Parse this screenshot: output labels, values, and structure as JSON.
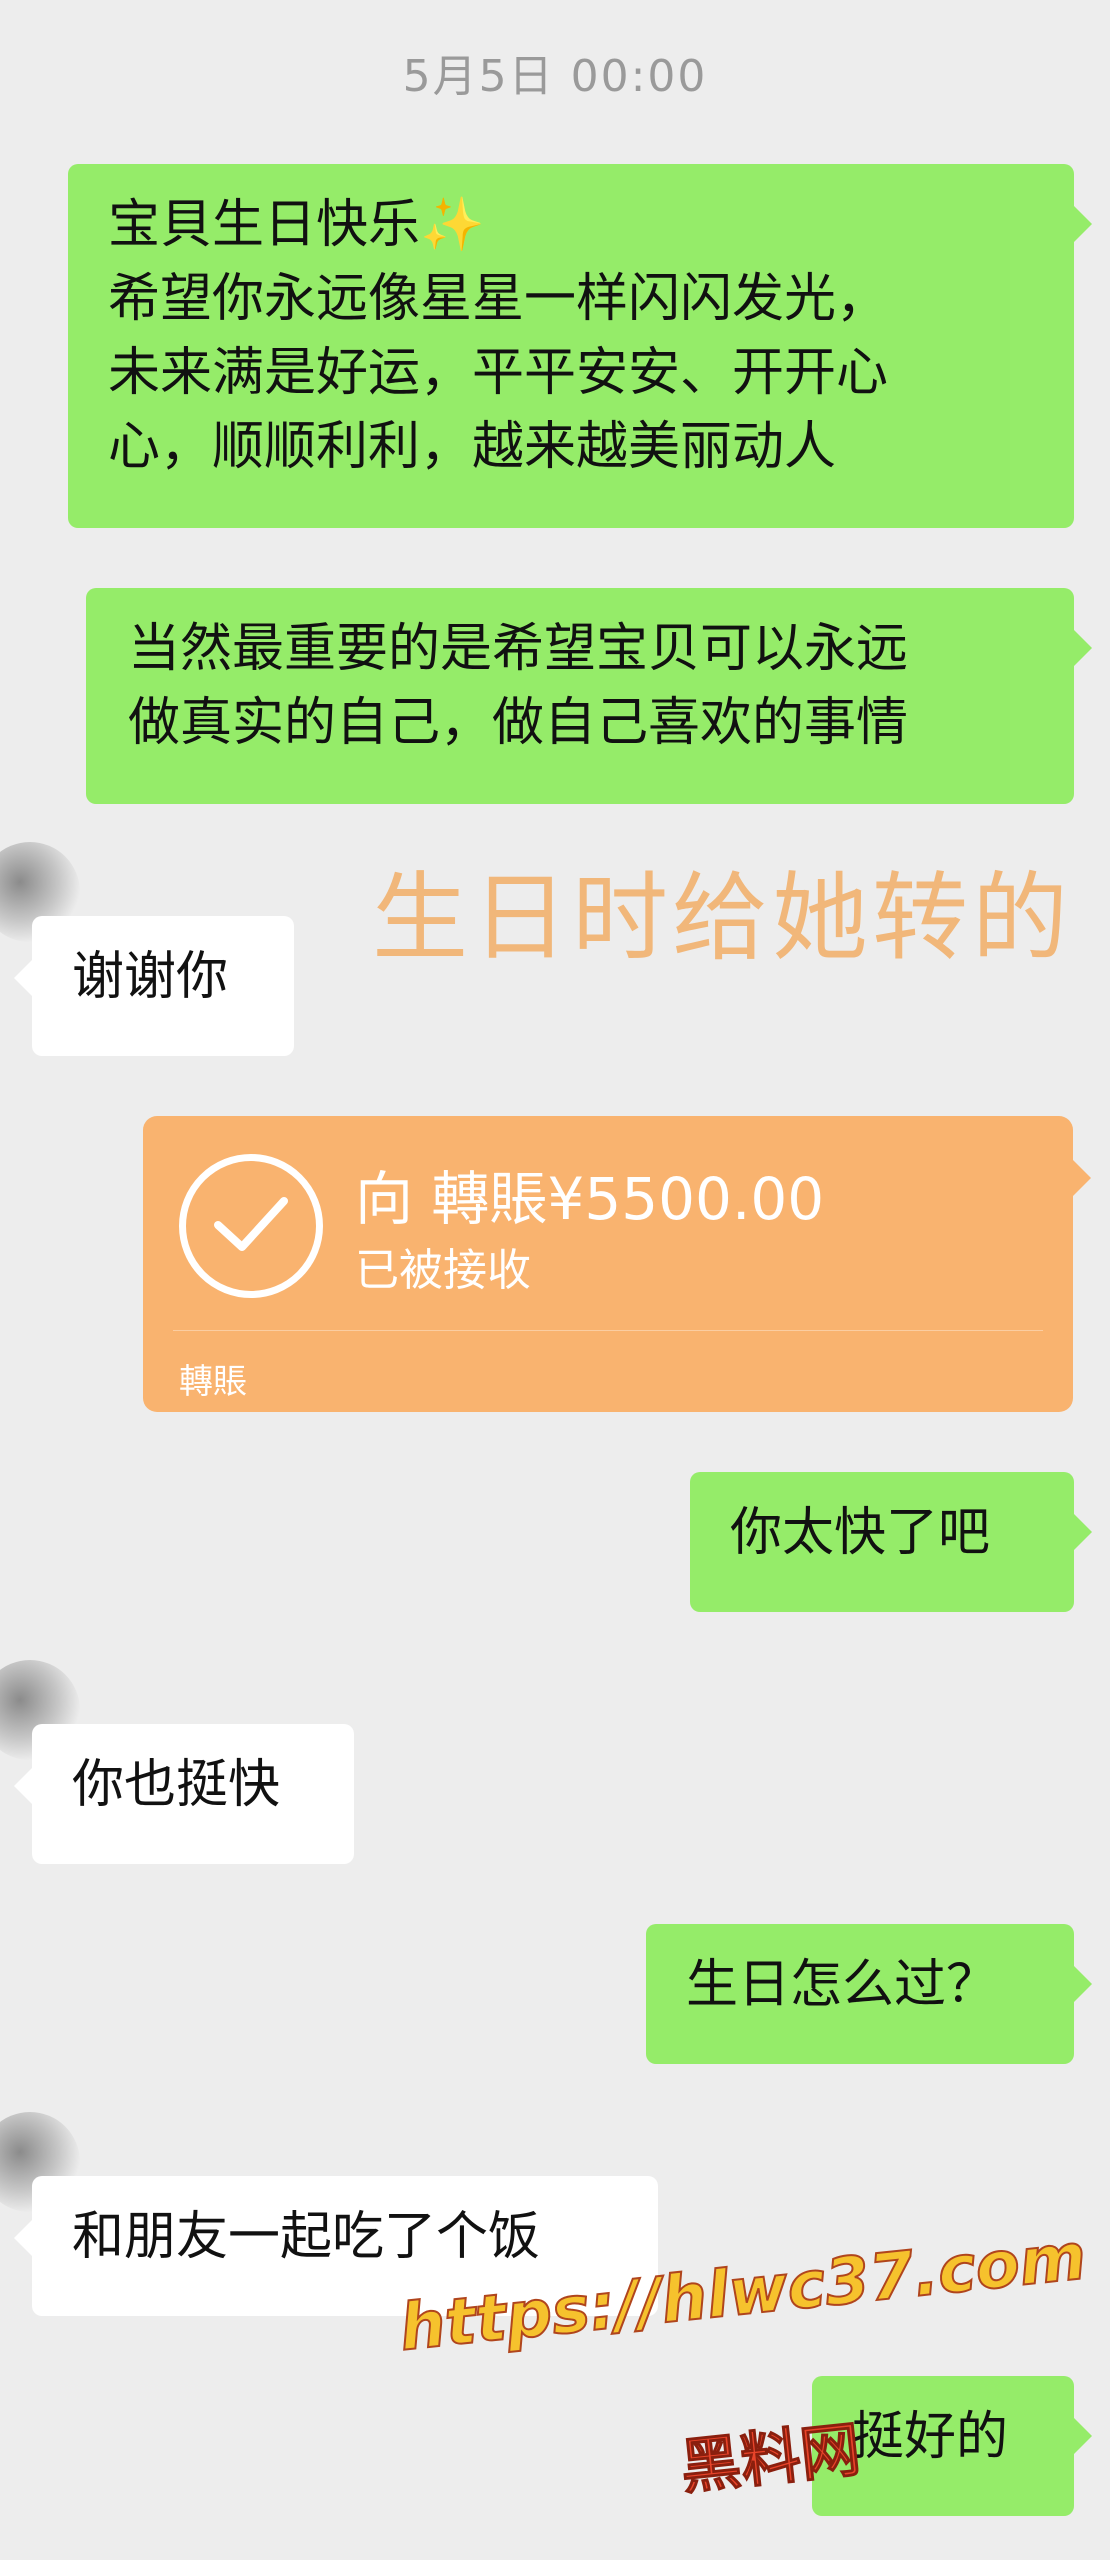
{
  "chat": {
    "timestamp": "5月5日 00:00",
    "messages": [
      {
        "text": "宝貝生日快乐✨\n希望你永远像星星一样闪闪发光，\n未来满是好运，平平安安、开开心\n心，顺顺利利，越来越美丽动人"
      },
      {
        "text": "当然最重要的是希望宝贝可以永远\n做真实的自己，做自己喜欢的事情"
      },
      {
        "text": "谢谢你"
      },
      {
        "text": "你太快了吧"
      },
      {
        "text": "你也挺快"
      },
      {
        "text": "生日怎么过？"
      },
      {
        "text": "和朋友一起吃了个饭"
      },
      {
        "text": "挺好的"
      }
    ],
    "transfer": {
      "amount_line": "向 轉賬¥5500.00",
      "status": "已被接收",
      "footer": "轉賬",
      "color": "#f9b36f"
    }
  },
  "overlay": {
    "caption": "生日时给她转的",
    "watermark_url": "https://hlwc37.com",
    "watermark_name": "黑料网"
  },
  "colors": {
    "outgoing_bubble": "#95ec69",
    "incoming_bubble": "#ffffff",
    "background": "#ededed"
  }
}
